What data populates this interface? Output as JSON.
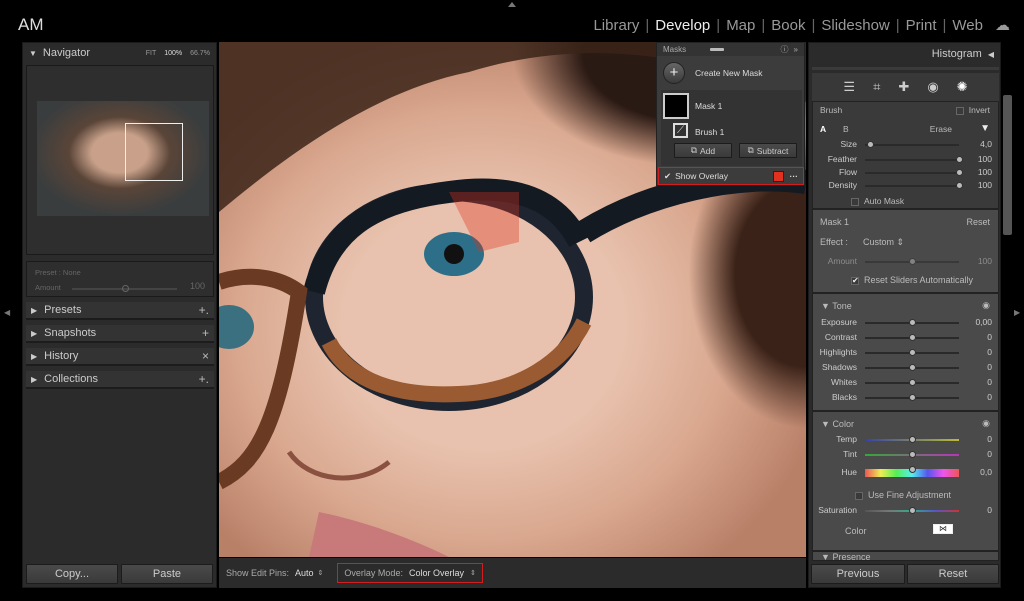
{
  "app": {
    "identity": "AM",
    "modules": [
      "Library",
      "Develop",
      "Map",
      "Book",
      "Slideshow",
      "Print",
      "Web"
    ],
    "active_module": "Develop"
  },
  "navigator": {
    "title": "Navigator",
    "zoom_fit": "FIT",
    "zoom_100": "100%",
    "zoom_custom": "66.7%"
  },
  "preset": {
    "label": "Preset : None",
    "amount_label": "Amount",
    "amount_value": "100",
    "amount_fraction": 0.5
  },
  "left_sections": [
    {
      "label": "Presets",
      "action": "+."
    },
    {
      "label": "Snapshots",
      "action": "+"
    },
    {
      "label": "History",
      "action": "×"
    },
    {
      "label": "Collections",
      "action": "+."
    }
  ],
  "left_buttons": {
    "copy": "Copy...",
    "paste": "Paste"
  },
  "toolbar": {
    "edit_pins_label": "Show Edit Pins:",
    "edit_pins_value": "Auto",
    "overlay_mode_label": "Overlay Mode:",
    "overlay_mode_value": "Color Overlay"
  },
  "masks": {
    "title": "Masks",
    "create": "Create New Mask",
    "mask_name": "Mask 1",
    "brush_name": "Brush 1",
    "add": "Add",
    "subtract": "Subtract",
    "show_overlay": "Show Overlay",
    "show_overlay_checked": true,
    "overlay_color": "#e0301e"
  },
  "right": {
    "histogram_title": "Histogram",
    "brush": {
      "title": "Brush",
      "invert": "Invert",
      "a": "A",
      "b": "B",
      "erase": "Erase",
      "auto_mask": "Auto Mask",
      "sliders": [
        {
          "label": "Size",
          "value": "4,0",
          "pos": 0.05
        },
        {
          "label": "Feather",
          "value": "100",
          "pos": 1
        },
        {
          "label": "Flow",
          "value": "100",
          "pos": 1
        },
        {
          "label": "Density",
          "value": "100",
          "pos": 1
        }
      ]
    },
    "mask": {
      "title": "Mask 1",
      "reset": "Reset",
      "effect_label": "Effect :",
      "effect_value": "Custom",
      "amount_label": "Amount",
      "amount_value": "100",
      "amount_pos": 0.5,
      "reset_sliders": "Reset Sliders Automatically"
    },
    "tone": {
      "title": "Tone",
      "sliders": [
        {
          "label": "Exposure",
          "value": "0,00",
          "pos": 0.5
        },
        {
          "label": "Contrast",
          "value": "0",
          "pos": 0.5
        },
        {
          "label": "Highlights",
          "value": "0",
          "pos": 0.5
        },
        {
          "label": "Shadows",
          "value": "0",
          "pos": 0.5
        },
        {
          "label": "Whites",
          "value": "0",
          "pos": 0.5
        },
        {
          "label": "Blacks",
          "value": "0",
          "pos": 0.5
        }
      ]
    },
    "color": {
      "title": "Color",
      "sliders": [
        {
          "label": "Temp",
          "value": "0",
          "pos": 0.5
        },
        {
          "label": "Tint",
          "value": "0",
          "pos": 0.5
        },
        {
          "label": "Hue",
          "value": "0,0",
          "pos": 0.5
        }
      ],
      "fine": "Use Fine Adjustment",
      "saturation": {
        "label": "Saturation",
        "value": "0",
        "pos": 0.5
      },
      "color_label": "Color"
    },
    "presence": {
      "title": "Presence"
    },
    "previous": "Previous",
    "reset": "Reset"
  }
}
